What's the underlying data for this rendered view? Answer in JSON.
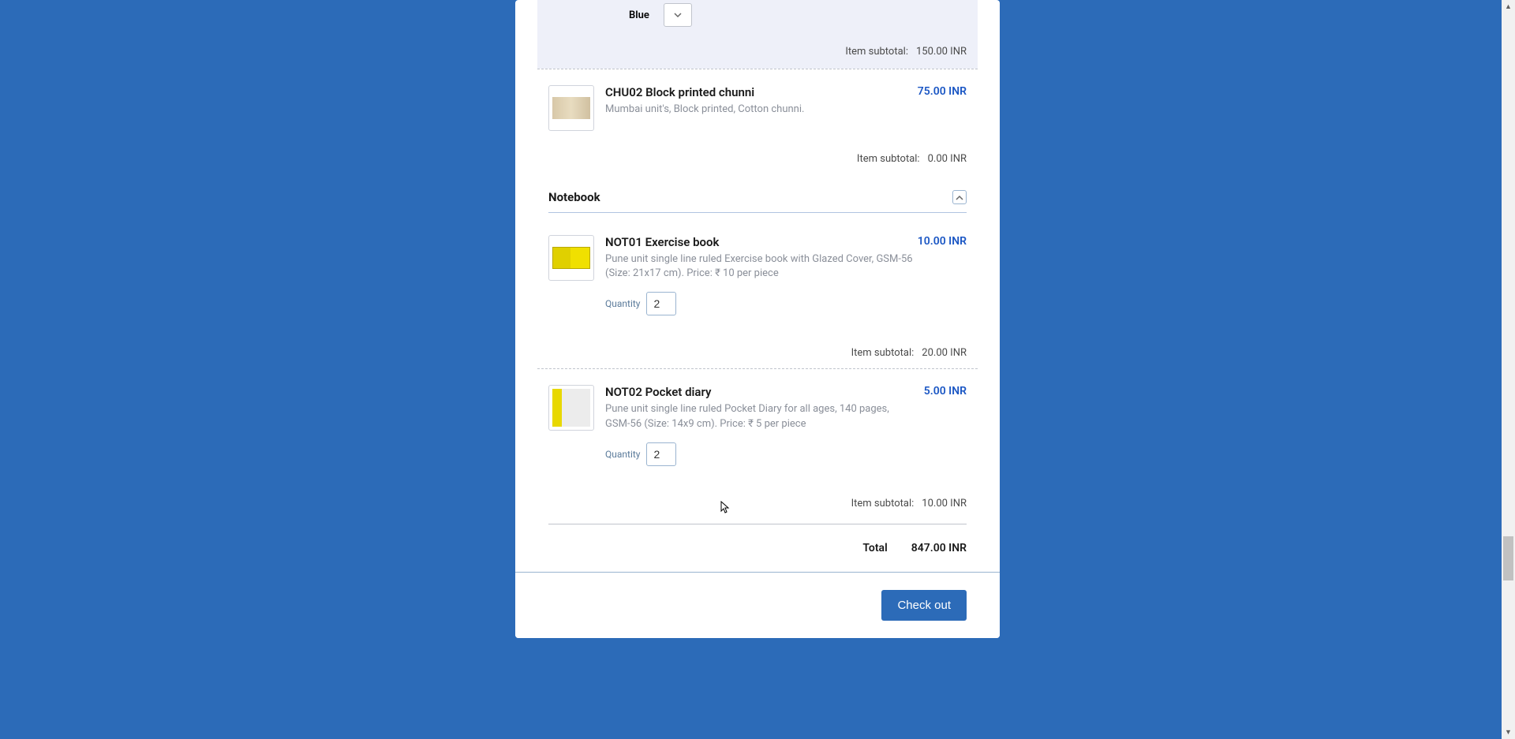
{
  "first_item": {
    "color_label": "Blue",
    "subtotal_label": "Item subtotal:",
    "subtotal_value": "150.00 INR"
  },
  "items": [
    {
      "title": "CHU02 Block printed chunni",
      "price": "75.00 INR",
      "desc": "Mumbai unit's, Block printed, Cotton chunni.",
      "subtotal_label": "Item subtotal:",
      "subtotal_value": "0.00 INR"
    }
  ],
  "section": {
    "title": "Notebook"
  },
  "notebook_items": [
    {
      "title": "NOT01 Exercise book",
      "price": "10.00 INR",
      "desc": "Pune unit single line ruled Exercise book with Glazed Cover, GSM-56 (Size: 21x17 cm). Price: ₹ 10 per piece",
      "quantity_label": "Quantity",
      "quantity_value": "2",
      "subtotal_label": "Item subtotal:",
      "subtotal_value": "20.00 INR"
    },
    {
      "title": "NOT02 Pocket diary",
      "price": "5.00 INR",
      "desc": "Pune unit single line ruled Pocket Diary for all ages, 140 pages, GSM-56 (Size: 14x9 cm). Price: ₹ 5 per piece",
      "quantity_label": "Quantity",
      "quantity_value": "2",
      "subtotal_label": "Item subtotal:",
      "subtotal_value": "10.00 INR"
    }
  ],
  "totals": {
    "label": "Total",
    "value": "847.00 INR"
  },
  "footer": {
    "checkout_label": "Check out"
  }
}
